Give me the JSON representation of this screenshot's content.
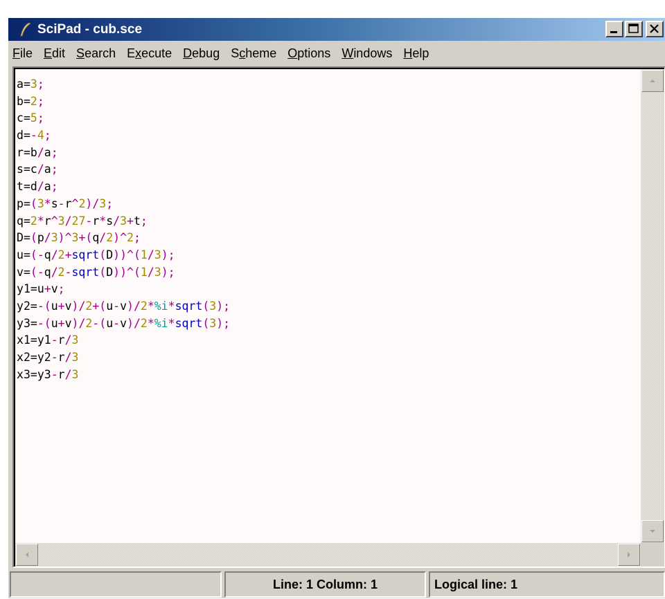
{
  "window": {
    "title": "SciPad - cub.sce",
    "buttons": {
      "minimize": "minimize-icon",
      "maximize": "maximize-icon",
      "close": "close-icon"
    }
  },
  "menu": [
    {
      "label": "File",
      "mnemonic": 0
    },
    {
      "label": "Edit",
      "mnemonic": 0
    },
    {
      "label": "Search",
      "mnemonic": 0
    },
    {
      "label": "Execute",
      "mnemonic": 1
    },
    {
      "label": "Debug",
      "mnemonic": 0
    },
    {
      "label": "Scheme",
      "mnemonic": 1
    },
    {
      "label": "Options",
      "mnemonic": 0
    },
    {
      "label": "Windows",
      "mnemonic": 0
    },
    {
      "label": "Help",
      "mnemonic": 0
    }
  ],
  "colors": {
    "number": "#a08a00",
    "operator": "#a00080",
    "bracket": "#a000a0",
    "function": "#0000c0",
    "constant": "#00a0a0",
    "text": "#000000"
  },
  "code_lines": [
    "a=3;",
    "b=2;",
    "c=5;",
    "d=-4;",
    "r=b/a;",
    "s=c/a;",
    "t=d/a;",
    "p=(3*s-r^2)/3;",
    "q=2*r^3/27-r*s/3+t;",
    "D=(p/3)^3+(q/2)^2;",
    "u=(-q/2+sqrt(D))^(1/3);",
    "v=(-q/2-sqrt(D))^(1/3);",
    "y1=u+v;",
    "y2=-(u+v)/2+(u-v)/2*%i*sqrt(3);",
    "y3=-(u+v)/2-(u-v)/2*%i*sqrt(3);",
    "x1=y1-r/3",
    "x2=y2-r/3",
    "x3=y3-r/3"
  ],
  "status": {
    "empty": "",
    "position": "Line: 1 Column: 1",
    "logical": "Logical line: 1"
  }
}
